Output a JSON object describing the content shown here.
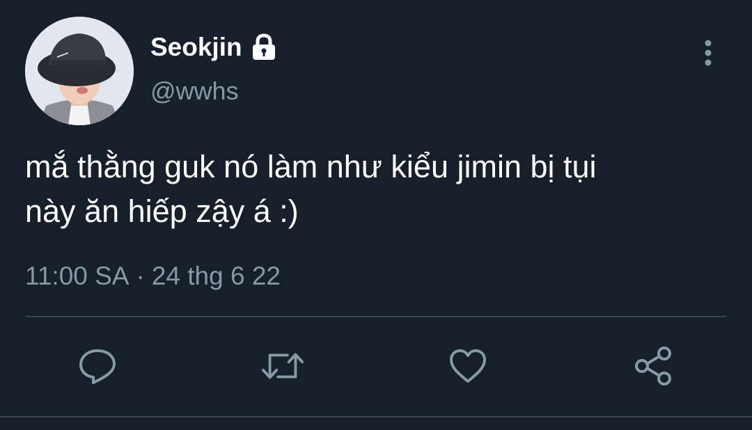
{
  "tweet": {
    "display_name": "Seokjin",
    "handle": "@wwhs",
    "text": "mắ thằng guk nó làm như kiểu jimin bị tụi\nnày ăn hiếp zậy á :)",
    "time": "11:00 SA",
    "separator": "·",
    "date": "24 thg 6 22",
    "protected_icon": "lock-icon",
    "more_icon": "vertical-ellipsis-icon"
  },
  "actions": [
    {
      "icon": "reply-icon"
    },
    {
      "icon": "retweet-icon"
    },
    {
      "icon": "like-icon"
    },
    {
      "icon": "share-icon"
    }
  ],
  "colors": {
    "background": "#15202b",
    "primary_text": "#ffffff",
    "secondary_text": "#8899a6",
    "divider": "#38444d"
  }
}
